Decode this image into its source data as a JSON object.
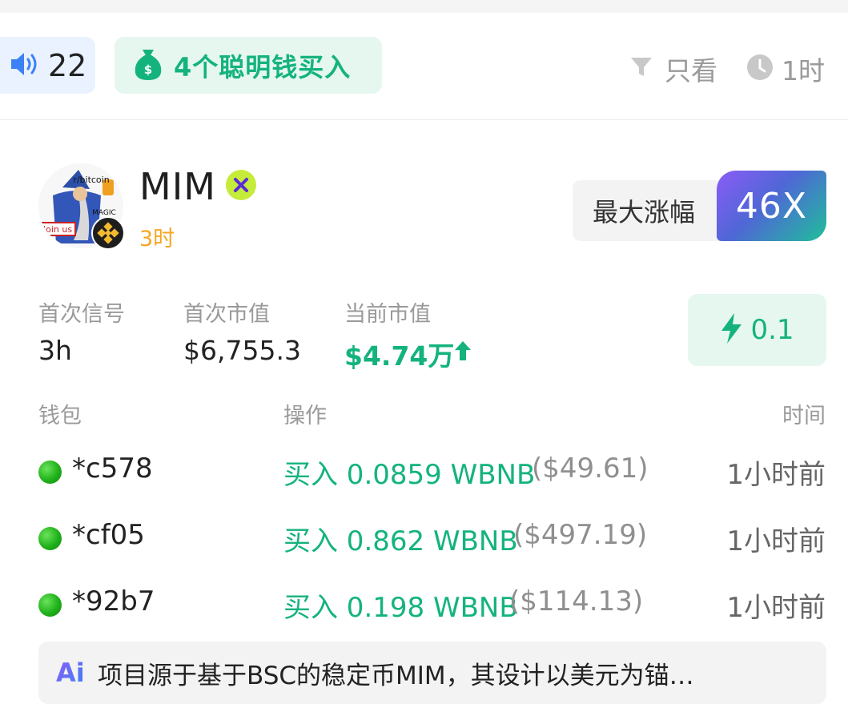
{
  "topbar": {
    "volume_count": "22",
    "smart_money_label": "4个聪明钱买入",
    "filter_label": "只看",
    "time_filter_label": "1时"
  },
  "token": {
    "name": "MIM",
    "age": "3时",
    "max_gain_label": "最大涨幅",
    "max_gain_value": "46X",
    "avatar_texts": [
      "r/bitcoin",
      "MAGIC",
      "Join us"
    ]
  },
  "stats": {
    "first_signal_label": "首次信号",
    "first_signal_value": "3h",
    "first_mcap_label": "首次市值",
    "first_mcap_value": "$6,755.3",
    "current_mcap_label": "当前市值",
    "current_mcap_value": "$4.74万",
    "boost_value": "0.1"
  },
  "table": {
    "headers": {
      "wallet": "钱包",
      "action": "操作",
      "time": "时间"
    },
    "rows": [
      {
        "wallet": "*c578",
        "action": "买入 0.0859 WBNB",
        "usd": "($49.61)",
        "time": "1小时前"
      },
      {
        "wallet": "*cf05",
        "action": "买入 0.862 WBNB",
        "usd": "($497.19)",
        "time": "1小时前"
      },
      {
        "wallet": "*92b7",
        "action": "买入 0.198 WBNB",
        "usd": "($114.13)",
        "time": "1小时前"
      }
    ]
  },
  "ai_summary": {
    "badge": "Ai",
    "text": "项目源于基于BSC的稳定币MIM，其设计以美元为锚…"
  },
  "colors": {
    "green": "#14b37d",
    "gray_text": "#9a9a9a",
    "orange": "#f5a623",
    "chip_blue_bg": "#eaf2ff",
    "chip_green_bg": "#e6f7f0"
  },
  "icons": [
    "speaker-icon",
    "money-bag-icon",
    "filter-icon",
    "clock-icon",
    "x-badge-icon",
    "bnb-chain-icon",
    "arrow-up-icon",
    "lightning-icon",
    "ai-icon"
  ]
}
